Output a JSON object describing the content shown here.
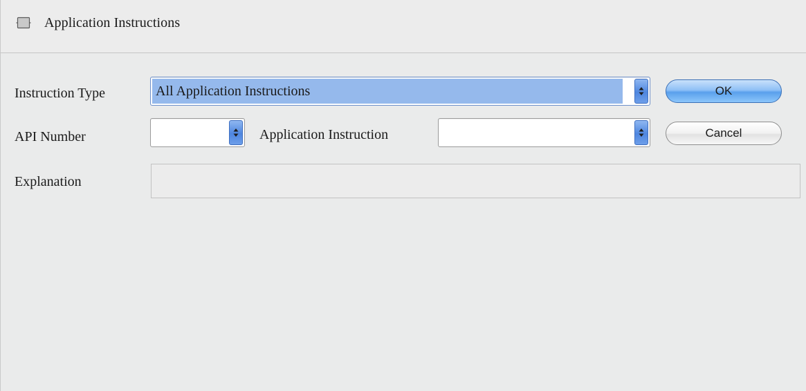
{
  "window": {
    "title": "Application Instructions",
    "title_icon": "window-icon"
  },
  "form": {
    "instruction_type": {
      "label": "Instruction Type",
      "value": "All Application Instructions"
    },
    "api_number": {
      "label": "API Number",
      "value": ""
    },
    "application_instruction": {
      "label": "Application Instruction",
      "value": ""
    },
    "explanation": {
      "label": "Explanation",
      "value": ""
    }
  },
  "buttons": {
    "ok_label": "OK",
    "cancel_label": "Cancel"
  },
  "icons": {
    "stepper": "up-down-arrows-icon"
  },
  "colors": {
    "selection": "#95b9ec",
    "stepper": "#4e86df",
    "ok_button": "#5aa0ec",
    "background": "#eaebeb"
  }
}
